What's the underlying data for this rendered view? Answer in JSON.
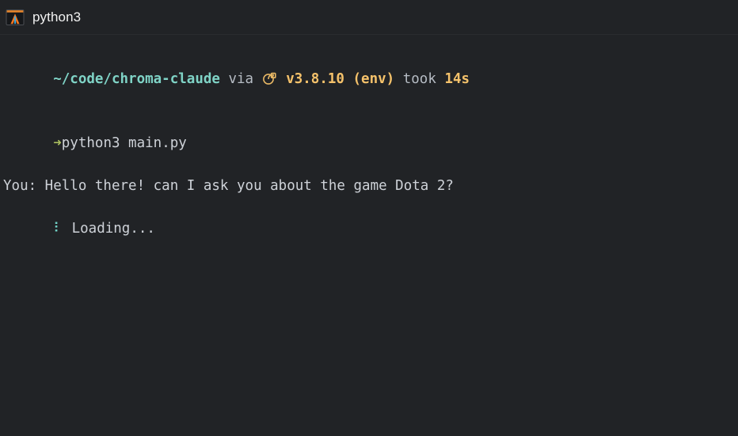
{
  "window": {
    "title": "python3",
    "icon": "python-app-icon",
    "background_color": "#212326",
    "titlebar_color": "#212326"
  },
  "terminal": {
    "prompt_line": {
      "path": "~/code/chroma-claude",
      "via_label": "via",
      "python_icon": "python-snake-icon",
      "version": "v3.8.10",
      "env": "(env)",
      "took_label": "took",
      "duration": "14s",
      "colors": {
        "path": "#7fd3c6",
        "via": "#b6bcc4",
        "version": "#f5c26b",
        "env": "#f5c26b",
        "took": "#b6bcc4",
        "duration": "#f5c26b"
      }
    },
    "command_line": {
      "arrow": "➜",
      "command": "python3 main.py",
      "arrow_color": "#a9bd5e"
    },
    "output_lines": [
      {
        "name": "user-message-line",
        "text": "You: Hello there! can I ask you about the game Dota 2?",
        "color": "#ced2d8"
      }
    ],
    "loading_line": {
      "spinner": "⠇",
      "text": "Loading...",
      "spinner_color": "#6fd0c4",
      "text_color": "#ced2d8"
    }
  }
}
